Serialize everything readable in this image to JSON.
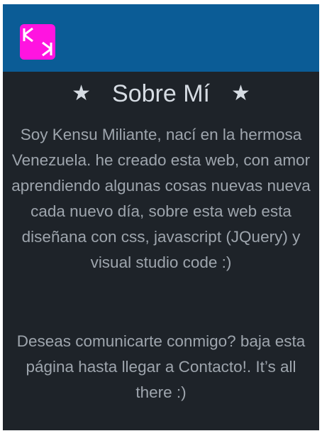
{
  "header": {
    "background_color": "#0b5c96",
    "logo": {
      "icon": "kk-logo-icon",
      "color": "#ff14e0"
    }
  },
  "about": {
    "star_left": "★",
    "title": "Sobre Mí",
    "star_right": "★",
    "paragraph": "Soy Kensu Miliante, nací en la hermosa Venezuela. he creado esta web, con amor aprendiendo algunas cosas nuevas nueva cada nuevo día, sobre esta web esta diseñana con css, javascript (JQuery) y visual studio code :)",
    "contact_paragraph": "Deseas comunicarte conmigo? baja esta página hasta llegar a Contacto!. It’s all there :)"
  },
  "colors": {
    "background": "#1e2329",
    "title": "#d6dce3",
    "body_text": "#9ea5ad"
  }
}
